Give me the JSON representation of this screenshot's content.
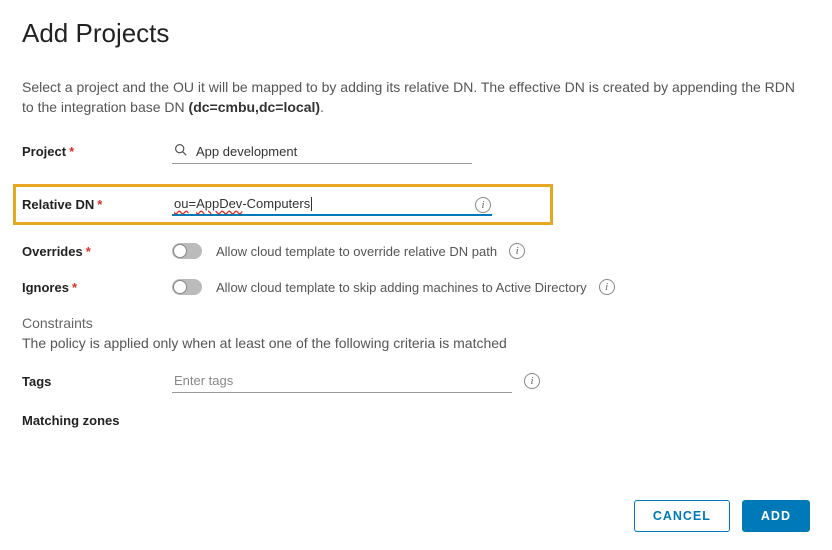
{
  "title": "Add Projects",
  "intro_a": "Select a project and the OU it will be mapped to by adding its relative DN. The effective DN is created by appending the RDN to the integration base DN ",
  "intro_b": "(dc=cmbu,dc=local)",
  "intro_c": ".",
  "labels": {
    "project": "Project",
    "relative_dn": "Relative DN",
    "overrides": "Overrides",
    "ignores": "Ignores",
    "constraints": "Constraints",
    "tags": "Tags",
    "matching_zones": "Matching zones"
  },
  "fields": {
    "project": {
      "value": "App development",
      "placeholder": ""
    },
    "relative_dn": {
      "value_a": "ou",
      "value_b": "=",
      "value_c": "AppDev",
      "value_d": "-Computers"
    },
    "tags": {
      "placeholder": "Enter tags"
    }
  },
  "toggles": {
    "overrides": {
      "on": false,
      "label": "Allow cloud template to override relative DN path"
    },
    "ignores": {
      "on": false,
      "label": "Allow cloud template to skip adding machines to Active Directory"
    }
  },
  "constraints_desc": "The policy is applied only when at least one of the following criteria is matched",
  "buttons": {
    "cancel": "CANCEL",
    "add": "ADD"
  }
}
